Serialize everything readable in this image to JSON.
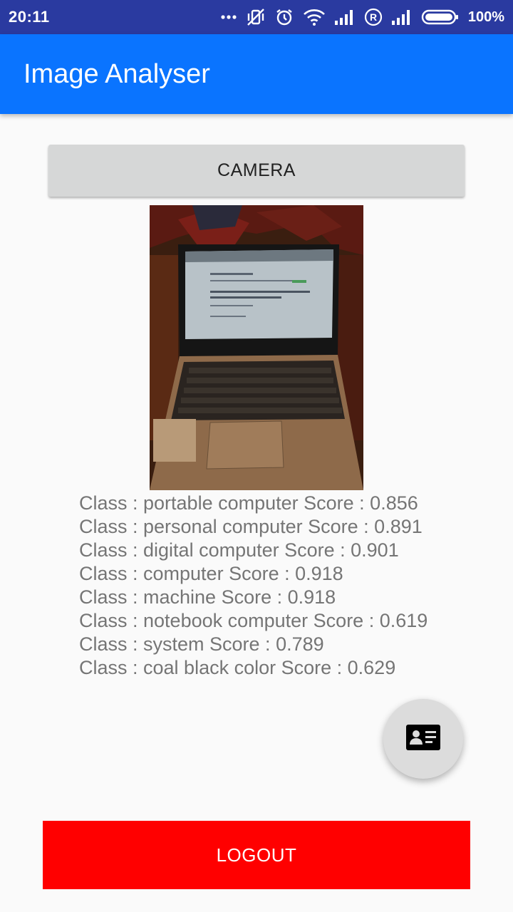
{
  "status_bar": {
    "time": "20:11",
    "battery": "100%",
    "icons": [
      "more-dots-icon",
      "vibrate-off-icon",
      "alarm-icon",
      "wifi-icon",
      "signal-icon",
      "roaming-icon",
      "signal-icon",
      "battery-icon"
    ]
  },
  "app_bar": {
    "title": "Image Analyser",
    "color": "#0a74ff"
  },
  "camera_button": {
    "label": "CAMERA"
  },
  "photo": {
    "subject": "laptop-photo"
  },
  "results": [
    "Class : portable computer Score : 0.856",
    "Class : personal computer Score : 0.891",
    "Class : digital computer Score : 0.901",
    "Class : computer Score : 0.918",
    "Class : machine Score : 0.918",
    "Class : notebook computer Score : 0.619",
    "Class : system Score : 0.789",
    "Class : coal black color Score : 0.629"
  ],
  "fab": {
    "icon": "contact-card-icon"
  },
  "logout_button": {
    "label": "LOGOUT",
    "color": "#ff0000"
  }
}
